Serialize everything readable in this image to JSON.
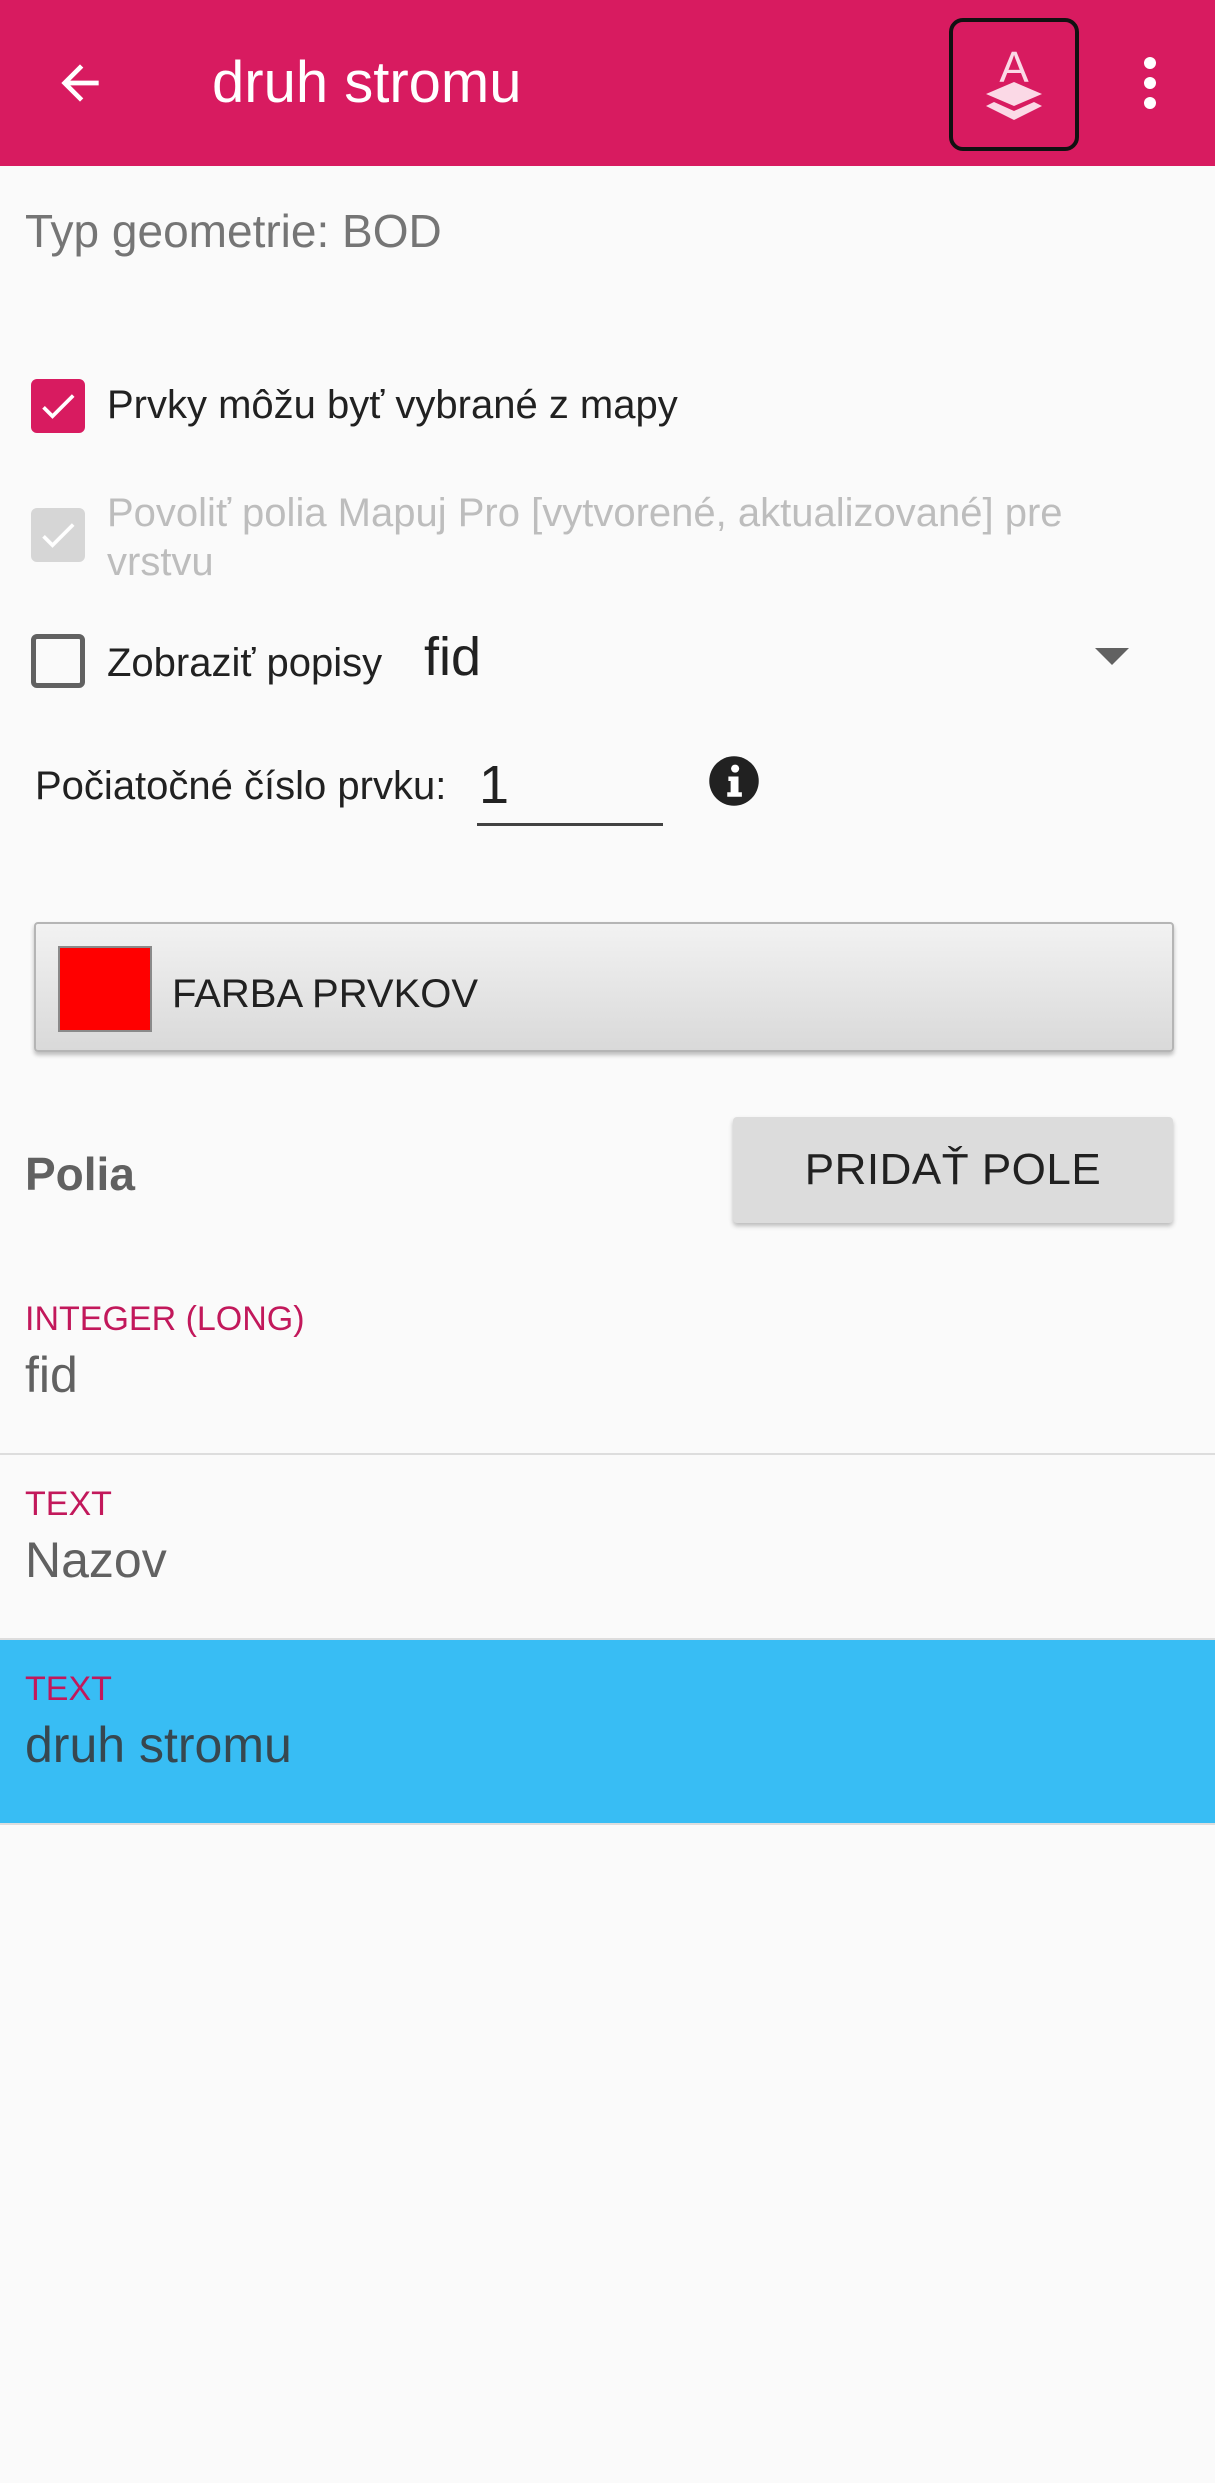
{
  "toolbar": {
    "title": "druh stromu",
    "back_icon": "arrow-left-icon",
    "layer_icon": "layer-a-icon",
    "overflow_icon": "more-vert-icon",
    "color": "#d81b60"
  },
  "geometry": {
    "label": "Typ geometrie: BOD"
  },
  "options": {
    "selectable_label": "Prvky môžu byť vybrané z mapy",
    "selectable_checked": true,
    "mapuj_label": "Povoliť polia Mapuj Pro [vytvorené, aktualizované] pre vrstvu",
    "mapuj_checked": true,
    "mapuj_disabled": true,
    "labels_label": "Zobraziť popisy",
    "labels_checked": false,
    "labels_field": "fid"
  },
  "start_number": {
    "label": "Počiatočné číslo prvku:",
    "value": "1",
    "info_icon": "info-icon"
  },
  "feature_color": {
    "label": "FARBA PRVKOV",
    "color": "#ff0000"
  },
  "fields_section": {
    "title": "Polia",
    "add_button": "PRIDAŤ POLE"
  },
  "fields": [
    {
      "type": "INTEGER (LONG)",
      "name": "fid",
      "selected": false
    },
    {
      "type": "TEXT",
      "name": "Nazov",
      "selected": false
    },
    {
      "type": "TEXT",
      "name": "druh stromu",
      "selected": true
    }
  ],
  "selection_color": "#38bdf4"
}
